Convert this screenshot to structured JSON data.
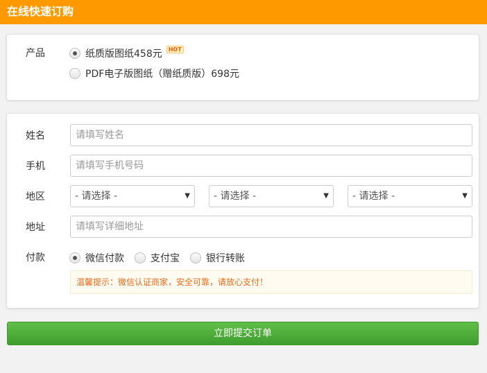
{
  "header": {
    "title": "在线快速订购"
  },
  "product": {
    "label": "产品",
    "options": [
      {
        "text": "纸质版图纸458元",
        "badge": "HOT",
        "checked": true
      },
      {
        "text": "PDF电子版图纸（赠纸质版）698元",
        "checked": false
      }
    ]
  },
  "form": {
    "name": {
      "label": "姓名",
      "placeholder": "请填写姓名"
    },
    "phone": {
      "label": "手机",
      "placeholder": "请填写手机号码"
    },
    "region": {
      "label": "地区",
      "selects": [
        "- 请选择 -",
        "- 请选择 -",
        "- 请选择 -"
      ]
    },
    "address": {
      "label": "地址",
      "placeholder": "请填写详细地址"
    },
    "payment": {
      "label": "付款",
      "options": [
        {
          "text": "微信付款",
          "checked": true
        },
        {
          "text": "支付宝",
          "checked": false
        },
        {
          "text": "银行转账",
          "checked": false
        }
      ]
    },
    "notice": "温馨提示：微信认证商家，安全可靠，请放心支付！"
  },
  "submit": {
    "label": "立即提交订单"
  },
  "colors": {
    "header": "#ff9900",
    "submit": "#4cae3a",
    "notice_text": "#e86a1a"
  }
}
